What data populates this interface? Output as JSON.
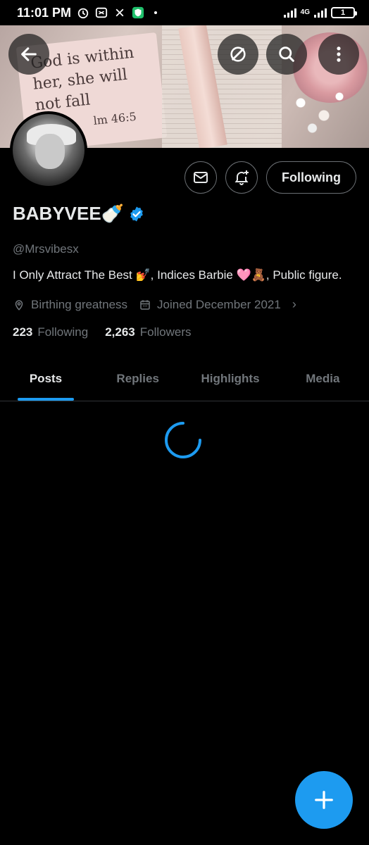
{
  "status_bar": {
    "time": "11:01 PM",
    "network": "4G",
    "battery": "1"
  },
  "profile": {
    "name": "BABYVEE🍼",
    "handle": "@Mrsvibesx",
    "bio": "I Only Attract The Best 💅, Indices Barbie 🩷🧸, Public figure.",
    "location": "Birthing greatness",
    "joined": "Joined December 2021",
    "following_count": "223",
    "following_label": "Following",
    "followers_count": "2,263",
    "followers_label": "Followers",
    "verified": true
  },
  "banner": {
    "quote_line1": "God is within",
    "quote_line2": "her, she will",
    "quote_line3": "not fall",
    "quote_ref": "lm 46:5"
  },
  "actions": {
    "following_button": "Following"
  },
  "tabs": [
    {
      "label": "Posts",
      "active": true
    },
    {
      "label": "Replies",
      "active": false
    },
    {
      "label": "Highlights",
      "active": false
    },
    {
      "label": "Media",
      "active": false
    }
  ],
  "colors": {
    "accent": "#1d9bf0",
    "background": "#000000",
    "secondary_text": "#71767b",
    "primary_text": "#e7e9ea"
  },
  "icons": {
    "back": "arrow-left-icon",
    "grok": "grok-icon",
    "search": "search-icon",
    "more": "more-vertical-icon",
    "message": "mail-icon",
    "notify": "bell-plus-icon",
    "location": "location-pin-icon",
    "calendar": "calendar-icon",
    "verified": "verified-badge-icon",
    "compose": "plus-icon"
  }
}
